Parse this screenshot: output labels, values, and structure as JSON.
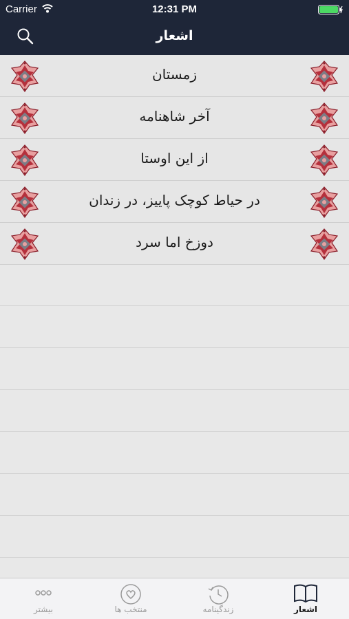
{
  "status_bar": {
    "carrier": "Carrier",
    "time": "12:31 PM"
  },
  "nav": {
    "title": "اشعار",
    "search_icon": "search-icon"
  },
  "poems": [
    {
      "title": "زمستان"
    },
    {
      "title": "آخر شاهنامه"
    },
    {
      "title": "از این اوستا"
    },
    {
      "title": "در حیاط کوچک پاییز، در زندان"
    },
    {
      "title": "دوزخ اما سرد"
    }
  ],
  "tabs": [
    {
      "label": "بیشتر",
      "icon": "more-icon"
    },
    {
      "label": "منتخب ها",
      "icon": "heart-icon"
    },
    {
      "label": "زندگینامه",
      "icon": "history-icon"
    },
    {
      "label": "اشعار",
      "icon": "book-icon",
      "active": true
    }
  ],
  "colors": {
    "nav_bg": "#1e2638",
    "list_bg": "#e6e6e6",
    "battery": "#4cd964",
    "ornament_red": "#b5303c",
    "ornament_pink": "#e8a0a0"
  }
}
